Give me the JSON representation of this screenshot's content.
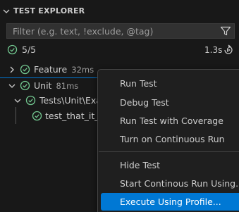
{
  "panel": {
    "title": "TEST EXPLORER",
    "filter_placeholder": "Filter (e.g. text, !exclude, @tag)",
    "summary": {
      "count": "5/5",
      "duration": "1.3s"
    }
  },
  "tree": [
    {
      "label": "Feature",
      "time": "32ms"
    },
    {
      "label": "Unit",
      "time": "81ms"
    },
    {
      "label": "Tests\\Unit\\Exar",
      "time": ""
    },
    {
      "label": "test_that_it_is",
      "time": ""
    }
  ],
  "context_menu": {
    "items": [
      "Run Test",
      "Debug Test",
      "Run Test with Coverage",
      "Turn on Continuous Run",
      "Hide Test",
      "Start Continous Run Using...",
      "Execute Using Profile..."
    ],
    "active_index": 6
  },
  "colors": {
    "pass": "#73c991",
    "accent": "#0078d4",
    "background": "#181818",
    "menu_background": "#1f1f1f"
  }
}
